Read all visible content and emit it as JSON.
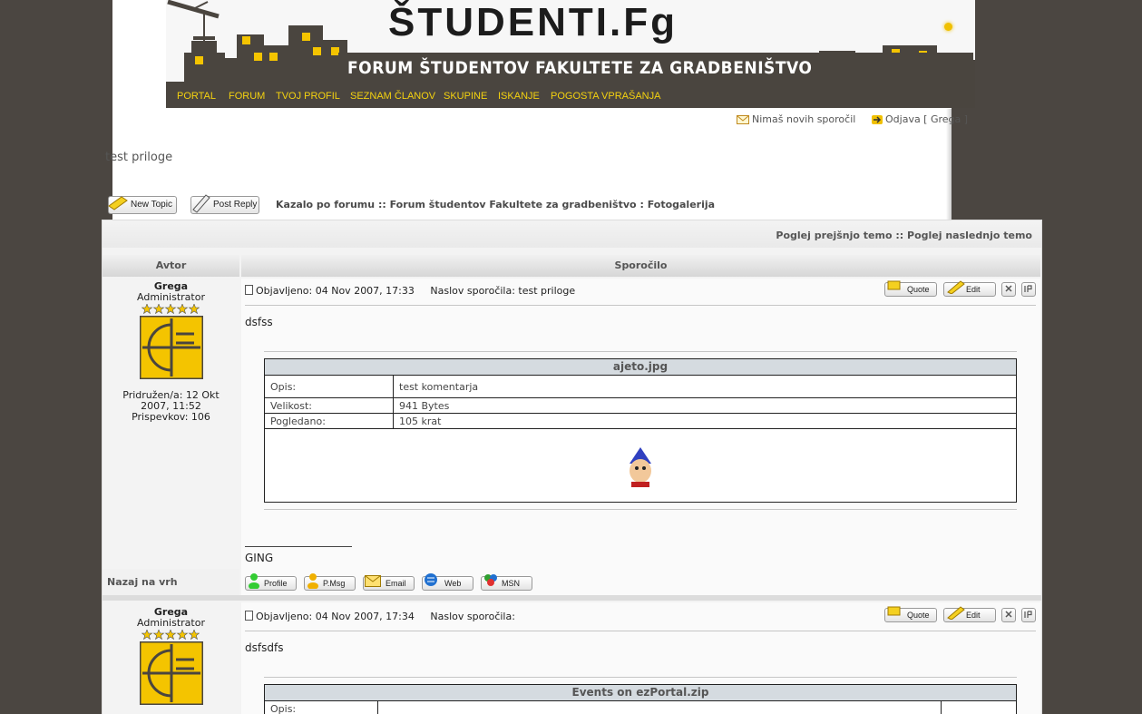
{
  "banner": {
    "logo": "ŠTUDENTI.Fg",
    "subtitle": "FORUM ŠTUDENTOV FAKULTETE ZA GRADBENIŠTVO"
  },
  "nav": {
    "items": [
      "PORTAL",
      "FORUM",
      "TVOJ PROFIL",
      "SEZNAM ČLANOV",
      "SKUPINE",
      "ISKANJE",
      "POGOSTA VPRAŠANJA"
    ]
  },
  "status": {
    "messages": "Nimaš novih sporočil",
    "logout": "Odjava [ Grega ]"
  },
  "topic": {
    "title": "test priloge",
    "new_topic": "New Topic",
    "post_reply": "Post Reply"
  },
  "breadcrumb": {
    "index": "Kazalo po forumu",
    "sep": "::",
    "forum": "Forum študentov Fakultete za gradbeništvo",
    "colon": ":",
    "sub": "Fotogalerija"
  },
  "topic_nav": {
    "prev": "Poglej prejšnjo temo",
    "sep": "::",
    "next": "Poglej naslednjo temo"
  },
  "table_headers": {
    "author": "Avtor",
    "message": "Sporočilo"
  },
  "post_buttons": {
    "quote": "Quote",
    "edit": "Edit"
  },
  "profile_buttons": {
    "profile": "Profile",
    "pm": "P.Msg",
    "email": "Email",
    "web": "Web",
    "msn": "MSN"
  },
  "back_to_top": "Nazaj na vrh",
  "posts": [
    {
      "author": "Grega",
      "rank": "Administrator",
      "joined_line1": "Pridružen/a: 12 Okt",
      "joined_line2": "2007, 11:52",
      "posts_count": "Prispevkov: 106",
      "posted": "Objavljeno: 04 Nov 2007, 17:33",
      "subject": "Naslov sporočila: test priloge",
      "body": "dsfss",
      "signature": "GING",
      "attachment": {
        "filename": "ajeto.jpg",
        "desc_label": "Opis:",
        "desc": "test komentarja",
        "size_label": "Velikost:",
        "size": "941 Bytes",
        "views_label": "Pogledano:",
        "views": "105 krat"
      }
    },
    {
      "author": "Grega",
      "rank": "Administrator",
      "posted": "Objavljeno: 04 Nov 2007, 17:34",
      "subject": "Naslov sporočila:",
      "body": "dsfsdfs",
      "attachment": {
        "filename": "Events on ezPortal.zip",
        "desc_label": "Opis:"
      }
    }
  ],
  "colors": {
    "background": "#4b4641",
    "nav_link": "#f4d20f",
    "building": "#4a453f",
    "window": "#f4c400"
  }
}
